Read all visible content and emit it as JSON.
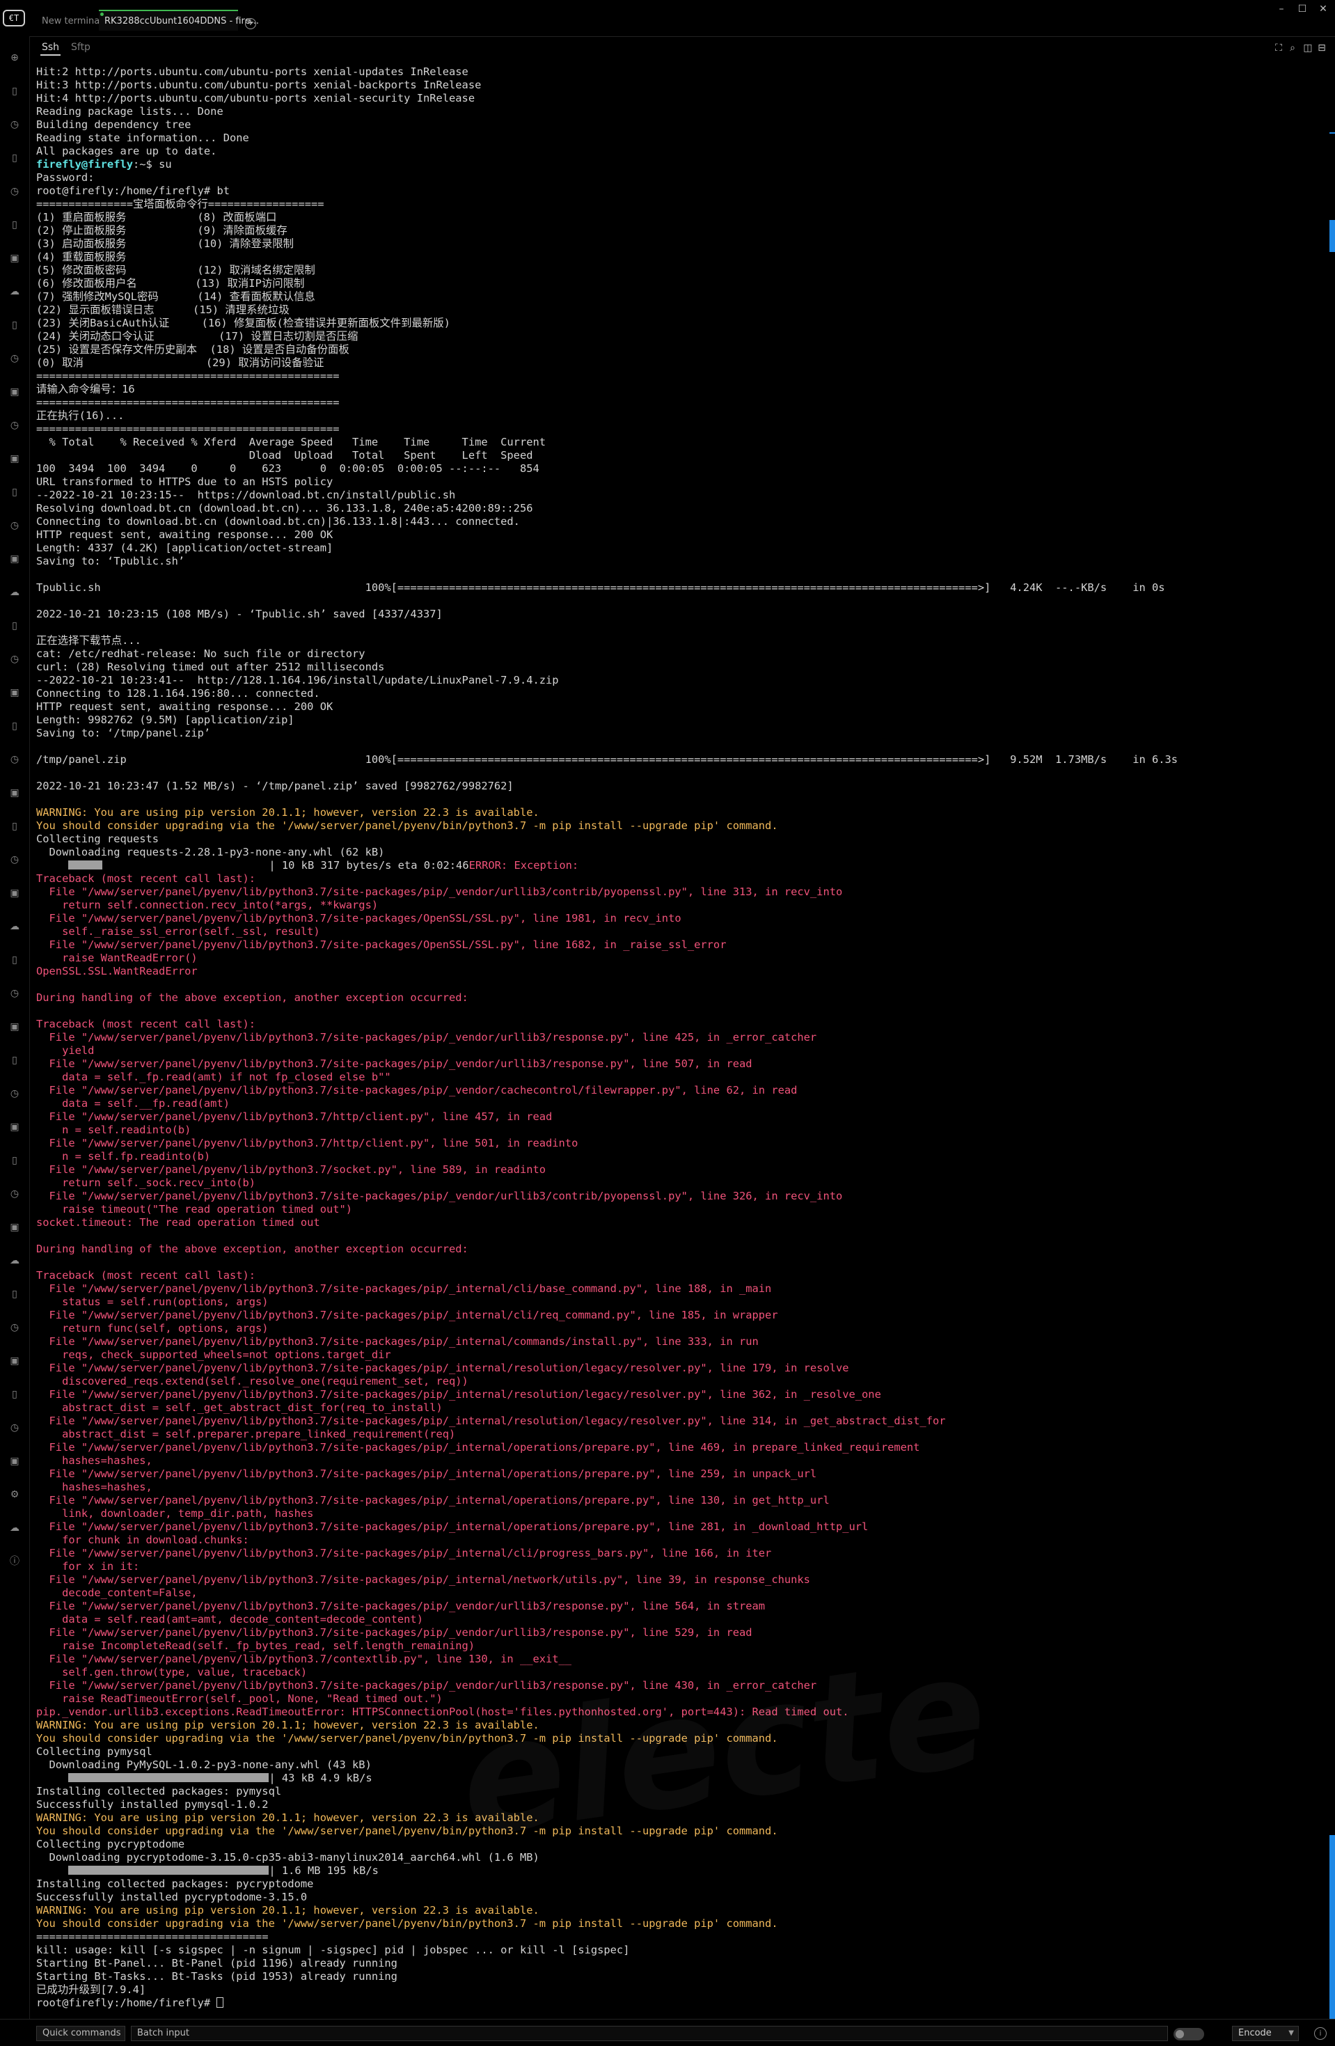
{
  "app": {
    "logo_text": "€T",
    "watermark": "electerm"
  },
  "tabs": [
    {
      "label": "New terminal"
    },
    {
      "label": "RK3288ccUbunt1604DDNS - fire..."
    }
  ],
  "subtabs": [
    {
      "label": "Ssh"
    },
    {
      "label": "Sftp"
    }
  ],
  "terminal": {
    "lines": [
      {
        "t": "Hit:2 http://ports.ubuntu.com/ubuntu-ports xenial-updates InRelease"
      },
      {
        "t": "Hit:3 http://ports.ubuntu.com/ubuntu-ports xenial-backports InRelease"
      },
      {
        "t": "Hit:4 http://ports.ubuntu.com/ubuntu-ports xenial-security InRelease"
      },
      {
        "t": "Reading package lists... Done"
      },
      {
        "t": "Building dependency tree"
      },
      {
        "t": "Reading state information... Done"
      },
      {
        "t": "All packages are up to date."
      },
      {
        "p": "firefly@firefly",
        "t": ":~$ su"
      },
      {
        "t": "Password:"
      },
      {
        "t": "root@firefly:/home/firefly# bt"
      },
      {
        "t": "===============宝塔面板命令行=================="
      },
      {
        "t": "(1) 重启面板服务           (8) 改面板端口"
      },
      {
        "t": "(2) 停止面板服务           (9) 清除面板缓存"
      },
      {
        "t": "(3) 启动面板服务           (10) 清除登录限制"
      },
      {
        "t": "(4) 重载面板服务"
      },
      {
        "t": "(5) 修改面板密码           (12) 取消域名绑定限制"
      },
      {
        "t": "(6) 修改面板用户名         (13) 取消IP访问限制"
      },
      {
        "t": "(7) 强制修改MySQL密码      (14) 查看面板默认信息"
      },
      {
        "t": "(22) 显示面板错误日志      (15) 清理系统垃圾"
      },
      {
        "t": "(23) 关闭BasicAuth认证     (16) 修复面板(检查错误并更新面板文件到最新版)"
      },
      {
        "t": "(24) 关闭动态口令认证          (17) 设置日志切割是否压缩"
      },
      {
        "t": "(25) 设置是否保存文件历史副本  (18) 设置是否自动备份面板"
      },
      {
        "t": "(0) 取消                   (29) 取消访问设备验证"
      },
      {
        "t": "==============================================="
      },
      {
        "t": "请输入命令编号：16"
      },
      {
        "t": "==============================================="
      },
      {
        "t": "正在执行(16)..."
      },
      {
        "t": "==============================================="
      },
      {
        "t": "  % Total    % Received % Xferd  Average Speed   Time    Time     Time  Current"
      },
      {
        "t": "                                 Dload  Upload   Total   Spent    Left  Speed"
      },
      {
        "t": "100  3494  100  3494    0     0    623      0  0:00:05  0:00:05 --:--:--   854"
      },
      {
        "t": "URL transformed to HTTPS due to an HSTS policy"
      },
      {
        "t": "--2022-10-21 10:23:15--  https://download.bt.cn/install/public.sh"
      },
      {
        "t": "Resolving download.bt.cn (download.bt.cn)... 36.133.1.8, 240e:a5:4200:89::256"
      },
      {
        "t": "Connecting to download.bt.cn (download.bt.cn)|36.133.1.8|:443... connected."
      },
      {
        "t": "HTTP request sent, awaiting response... 200 OK"
      },
      {
        "t": "Length: 4337 (4.2K) [application/octet-stream]"
      },
      {
        "t": "Saving to: ‘Tpublic.sh’"
      },
      {
        "t": ""
      },
      {
        "t": "Tpublic.sh                                         100%[==========================================================================================>]   4.24K  --.-KB/s    in 0s"
      },
      {
        "t": ""
      },
      {
        "t": "2022-10-21 10:23:15 (108 MB/s) - ‘Tpublic.sh’ saved [4337/4337]"
      },
      {
        "t": ""
      },
      {
        "t": "正在选择下载节点..."
      },
      {
        "t": "cat: /etc/redhat-release: No such file or directory"
      },
      {
        "t": "curl: (28) Resolving timed out after 2512 milliseconds"
      },
      {
        "t": "--2022-10-21 10:23:41--  http://128.1.164.196/install/update/LinuxPanel-7.9.4.zip"
      },
      {
        "t": "Connecting to 128.1.164.196:80... connected."
      },
      {
        "t": "HTTP request sent, awaiting response... 200 OK"
      },
      {
        "t": "Length: 9982762 (9.5M) [application/zip]"
      },
      {
        "t": "Saving to: ‘/tmp/panel.zip’"
      },
      {
        "t": ""
      },
      {
        "t": "/tmp/panel.zip                                     100%[==========================================================================================>]   9.52M  1.73MB/s    in 6.3s"
      },
      {
        "t": ""
      },
      {
        "t": "2022-10-21 10:23:47 (1.52 MB/s) - ‘/tmp/panel.zip’ saved [9982762/9982762]"
      },
      {
        "t": ""
      },
      {
        "c": "warn",
        "t": "WARNING: You are using pip version 20.1.1; however, version 22.3 is available."
      },
      {
        "c": "warn",
        "t": "You should consider upgrading via the '/www/server/panel/pyenv/bin/python3.7 -m pip install --upgrade pip' command."
      },
      {
        "t": "Collecting requests"
      },
      {
        "t": "  Downloading requests-2.28.1-py3-none-any.whl (62 kB)"
      },
      {
        "bar": 0.17,
        "t": "| 10 kB 317 bytes/s eta 0:02:46",
        "tail": "ERROR: Exception:"
      },
      {
        "c": "err",
        "t": "Traceback (most recent call last):"
      },
      {
        "c": "err",
        "t": "  File \"/www/server/panel/pyenv/lib/python3.7/site-packages/pip/_vendor/urllib3/contrib/pyopenssl.py\", line 313, in recv_into"
      },
      {
        "c": "err",
        "t": "    return self.connection.recv_into(*args, **kwargs)"
      },
      {
        "c": "err",
        "t": "  File \"/www/server/panel/pyenv/lib/python3.7/site-packages/OpenSSL/SSL.py\", line 1981, in recv_into"
      },
      {
        "c": "err",
        "t": "    self._raise_ssl_error(self._ssl, result)"
      },
      {
        "c": "err",
        "t": "  File \"/www/server/panel/pyenv/lib/python3.7/site-packages/OpenSSL/SSL.py\", line 1682, in _raise_ssl_error"
      },
      {
        "c": "err",
        "t": "    raise WantReadError()"
      },
      {
        "c": "err",
        "t": "OpenSSL.SSL.WantReadError"
      },
      {
        "t": ""
      },
      {
        "c": "err",
        "t": "During handling of the above exception, another exception occurred:"
      },
      {
        "t": ""
      },
      {
        "c": "err",
        "t": "Traceback (most recent call last):"
      },
      {
        "c": "err",
        "t": "  File \"/www/server/panel/pyenv/lib/python3.7/site-packages/pip/_vendor/urllib3/response.py\", line 425, in _error_catcher"
      },
      {
        "c": "err",
        "t": "    yield"
      },
      {
        "c": "err",
        "t": "  File \"/www/server/panel/pyenv/lib/python3.7/site-packages/pip/_vendor/urllib3/response.py\", line 507, in read"
      },
      {
        "c": "err",
        "t": "    data = self._fp.read(amt) if not fp_closed else b\"\""
      },
      {
        "c": "err",
        "t": "  File \"/www/server/panel/pyenv/lib/python3.7/site-packages/pip/_vendor/cachecontrol/filewrapper.py\", line 62, in read"
      },
      {
        "c": "err",
        "t": "    data = self.__fp.read(amt)"
      },
      {
        "c": "err",
        "t": "  File \"/www/server/panel/pyenv/lib/python3.7/http/client.py\", line 457, in read"
      },
      {
        "c": "err",
        "t": "    n = self.readinto(b)"
      },
      {
        "c": "err",
        "t": "  File \"/www/server/panel/pyenv/lib/python3.7/http/client.py\", line 501, in readinto"
      },
      {
        "c": "err",
        "t": "    n = self.fp.readinto(b)"
      },
      {
        "c": "err",
        "t": "  File \"/www/server/panel/pyenv/lib/python3.7/socket.py\", line 589, in readinto"
      },
      {
        "c": "err",
        "t": "    return self._sock.recv_into(b)"
      },
      {
        "c": "err",
        "t": "  File \"/www/server/panel/pyenv/lib/python3.7/site-packages/pip/_vendor/urllib3/contrib/pyopenssl.py\", line 326, in recv_into"
      },
      {
        "c": "err",
        "t": "    raise timeout(\"The read operation timed out\")"
      },
      {
        "c": "err",
        "t": "socket.timeout: The read operation timed out"
      },
      {
        "t": ""
      },
      {
        "c": "err",
        "t": "During handling of the above exception, another exception occurred:"
      },
      {
        "t": ""
      },
      {
        "c": "err",
        "t": "Traceback (most recent call last):"
      },
      {
        "c": "err",
        "t": "  File \"/www/server/panel/pyenv/lib/python3.7/site-packages/pip/_internal/cli/base_command.py\", line 188, in _main"
      },
      {
        "c": "err",
        "t": "    status = self.run(options, args)"
      },
      {
        "c": "err",
        "t": "  File \"/www/server/panel/pyenv/lib/python3.7/site-packages/pip/_internal/cli/req_command.py\", line 185, in wrapper"
      },
      {
        "c": "err",
        "t": "    return func(self, options, args)"
      },
      {
        "c": "err",
        "t": "  File \"/www/server/panel/pyenv/lib/python3.7/site-packages/pip/_internal/commands/install.py\", line 333, in run"
      },
      {
        "c": "err",
        "t": "    reqs, check_supported_wheels=not options.target_dir"
      },
      {
        "c": "err",
        "t": "  File \"/www/server/panel/pyenv/lib/python3.7/site-packages/pip/_internal/resolution/legacy/resolver.py\", line 179, in resolve"
      },
      {
        "c": "err",
        "t": "    discovered_reqs.extend(self._resolve_one(requirement_set, req))"
      },
      {
        "c": "err",
        "t": "  File \"/www/server/panel/pyenv/lib/python3.7/site-packages/pip/_internal/resolution/legacy/resolver.py\", line 362, in _resolve_one"
      },
      {
        "c": "err",
        "t": "    abstract_dist = self._get_abstract_dist_for(req_to_install)"
      },
      {
        "c": "err",
        "t": "  File \"/www/server/panel/pyenv/lib/python3.7/site-packages/pip/_internal/resolution/legacy/resolver.py\", line 314, in _get_abstract_dist_for"
      },
      {
        "c": "err",
        "t": "    abstract_dist = self.preparer.prepare_linked_requirement(req)"
      },
      {
        "c": "err",
        "t": "  File \"/www/server/panel/pyenv/lib/python3.7/site-packages/pip/_internal/operations/prepare.py\", line 469, in prepare_linked_requirement"
      },
      {
        "c": "err",
        "t": "    hashes=hashes,"
      },
      {
        "c": "err",
        "t": "  File \"/www/server/panel/pyenv/lib/python3.7/site-packages/pip/_internal/operations/prepare.py\", line 259, in unpack_url"
      },
      {
        "c": "err",
        "t": "    hashes=hashes,"
      },
      {
        "c": "err",
        "t": "  File \"/www/server/panel/pyenv/lib/python3.7/site-packages/pip/_internal/operations/prepare.py\", line 130, in get_http_url"
      },
      {
        "c": "err",
        "t": "    link, downloader, temp_dir.path, hashes"
      },
      {
        "c": "err",
        "t": "  File \"/www/server/panel/pyenv/lib/python3.7/site-packages/pip/_internal/operations/prepare.py\", line 281, in _download_http_url"
      },
      {
        "c": "err",
        "t": "    for chunk in download.chunks:"
      },
      {
        "c": "err",
        "t": "  File \"/www/server/panel/pyenv/lib/python3.7/site-packages/pip/_internal/cli/progress_bars.py\", line 166, in iter"
      },
      {
        "c": "err",
        "t": "    for x in it:"
      },
      {
        "c": "err",
        "t": "  File \"/www/server/panel/pyenv/lib/python3.7/site-packages/pip/_internal/network/utils.py\", line 39, in response_chunks"
      },
      {
        "c": "err",
        "t": "    decode_content=False,"
      },
      {
        "c": "err",
        "t": "  File \"/www/server/panel/pyenv/lib/python3.7/site-packages/pip/_vendor/urllib3/response.py\", line 564, in stream"
      },
      {
        "c": "err",
        "t": "    data = self.read(amt=amt, decode_content=decode_content)"
      },
      {
        "c": "err",
        "t": "  File \"/www/server/panel/pyenv/lib/python3.7/site-packages/pip/_vendor/urllib3/response.py\", line 529, in read"
      },
      {
        "c": "err",
        "t": "    raise IncompleteRead(self._fp_bytes_read, self.length_remaining)"
      },
      {
        "c": "err",
        "t": "  File \"/www/server/panel/pyenv/lib/python3.7/contextlib.py\", line 130, in __exit__"
      },
      {
        "c": "err",
        "t": "    self.gen.throw(type, value, traceback)"
      },
      {
        "c": "err",
        "t": "  File \"/www/server/panel/pyenv/lib/python3.7/site-packages/pip/_vendor/urllib3/response.py\", line 430, in _error_catcher"
      },
      {
        "c": "err",
        "t": "    raise ReadTimeoutError(self._pool, None, \"Read timed out.\")"
      },
      {
        "c": "err",
        "t": "pip._vendor.urllib3.exceptions.ReadTimeoutError: HTTPSConnectionPool(host='files.pythonhosted.org', port=443): Read timed out."
      },
      {
        "c": "warn",
        "t": "WARNING: You are using pip version 20.1.1; however, version 22.3 is available."
      },
      {
        "c": "warn",
        "t": "You should consider upgrading via the '/www/server/panel/pyenv/bin/python3.7 -m pip install --upgrade pip' command."
      },
      {
        "t": "Collecting pymysql"
      },
      {
        "t": "  Downloading PyMySQL-1.0.2-py3-none-any.whl (43 kB)"
      },
      {
        "bar": 1,
        "t": "| 43 kB 4.9 kB/s"
      },
      {
        "t": "Installing collected packages: pymysql"
      },
      {
        "t": "Successfully installed pymysql-1.0.2"
      },
      {
        "c": "warn",
        "t": "WARNING: You are using pip version 20.1.1; however, version 22.3 is available."
      },
      {
        "c": "warn",
        "t": "You should consider upgrading via the '/www/server/panel/pyenv/bin/python3.7 -m pip install --upgrade pip' command."
      },
      {
        "t": "Collecting pycryptodome"
      },
      {
        "t": "  Downloading pycryptodome-3.15.0-cp35-abi3-manylinux2014_aarch64.whl (1.6 MB)"
      },
      {
        "bar": 1,
        "t": "| 1.6 MB 195 kB/s"
      },
      {
        "t": "Installing collected packages: pycryptodome"
      },
      {
        "t": "Successfully installed pycryptodome-3.15.0"
      },
      {
        "c": "warn",
        "t": "WARNING: You are using pip version 20.1.1; however, version 22.3 is available."
      },
      {
        "c": "warn",
        "t": "You should consider upgrading via the '/www/server/panel/pyenv/bin/python3.7 -m pip install --upgrade pip' command."
      },
      {
        "t": "===================================="
      },
      {
        "t": "kill: usage: kill [-s sigspec | -n signum | -sigspec] pid | jobspec ... or kill -l [sigspec]"
      },
      {
        "t": "Starting Bt-Panel... Bt-Panel (pid 1196) already running"
      },
      {
        "t": "Starting Bt-Tasks... Bt-Tasks (pid 1953) already running"
      },
      {
        "t": "已成功升级到[7.9.4]"
      },
      {
        "t": "root@firefly:/home/firefly# ",
        "cursor": true
      }
    ]
  },
  "bottom": {
    "quick_commands": "Quick commands",
    "batch_input": "Batch input",
    "encode": "Encode"
  },
  "colors": {
    "prompt": "#5fe0e0",
    "warning": "#f0b85a",
    "error": "#f0537a",
    "active_tab": "#3fb950",
    "scroll_marker": "#1e88e5"
  },
  "icons": {
    "sidebar": [
      "add-icon",
      "bookmark-icon",
      "history-icon",
      "bookmark-icon",
      "history-icon",
      "bookmark-icon",
      "image-icon",
      "cloud-icon",
      "bookmark-icon",
      "history-icon",
      "image-icon",
      "history-icon",
      "image-icon",
      "settings-icon",
      "cloud-upload-icon",
      "info-icon"
    ],
    "toolbar": [
      "fullscreen-icon",
      "search-icon",
      "split-vertical-icon",
      "split-horizontal-icon"
    ]
  }
}
